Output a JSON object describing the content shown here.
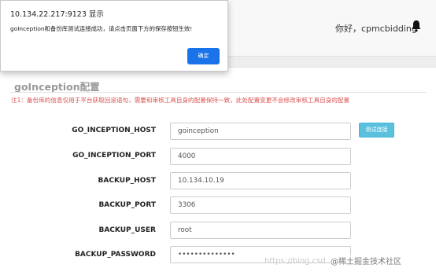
{
  "header": {
    "greeting": "你好，cpmcbidding",
    "bell_icon": "bell-icon"
  },
  "panel": {
    "title": "goInception配置",
    "note": "注1：备份库的信息仅用于平台获取回滚语句，需要和审核工具自身的配置保持一致，此处配置变更不会修改审核工具自身的配置"
  },
  "form": {
    "fields": [
      {
        "label": "GO_INCEPTION_HOST",
        "value": "goinception"
      },
      {
        "label": "GO_INCEPTION_PORT",
        "value": "4000"
      },
      {
        "label": "BACKUP_HOST",
        "value": "10.134.10.19"
      },
      {
        "label": "BACKUP_PORT",
        "value": "3306"
      },
      {
        "label": "BACKUP_USER",
        "value": "root"
      },
      {
        "label": "BACKUP_PASSWORD",
        "value": "••••••••••••••"
      }
    ],
    "test_button": "测试连接"
  },
  "dialog": {
    "title": "10.134.22.217:9123 显示",
    "message": "goInception和备份库测试连接成功，请点击页面下方的保存按钮生效!",
    "ok_button": "确定"
  },
  "watermark": {
    "url_text": "https://blog.csd",
    "source_badge": "@稀土掘金技术社区"
  }
}
